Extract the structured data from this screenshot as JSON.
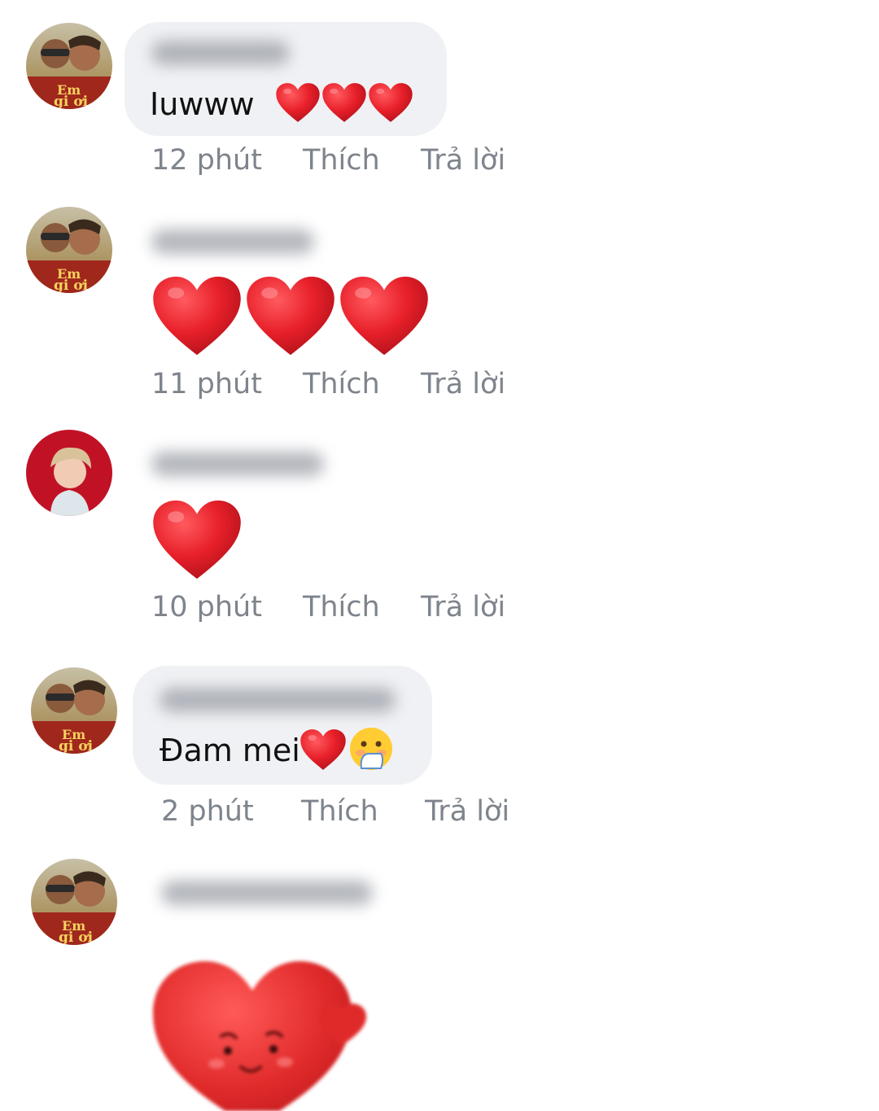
{
  "colors": {
    "bubble": "#f0f1f4",
    "heart": "#e8202a",
    "meta_text": "#7e848c"
  },
  "icons": {
    "heart": "red-heart-emoji",
    "hand_over_mouth": "face-with-hand-over-mouth-emoji",
    "sticker": "waving-heart-sticker"
  },
  "comments": [
    {
      "text": "Iuwww",
      "time": "12 phút",
      "like": "Thích",
      "reply": "Trả lời"
    },
    {
      "text": "",
      "time": "11 phút",
      "like": "Thích",
      "reply": "Trả lời"
    },
    {
      "text": "",
      "time": "10 phút",
      "like": "Thích",
      "reply": "Trả lời"
    },
    {
      "text": "Đam mei",
      "time": "2 phút",
      "like": "Thích",
      "reply": "Trả lời"
    },
    {
      "text": "",
      "time": "",
      "like": "",
      "reply": ""
    }
  ]
}
